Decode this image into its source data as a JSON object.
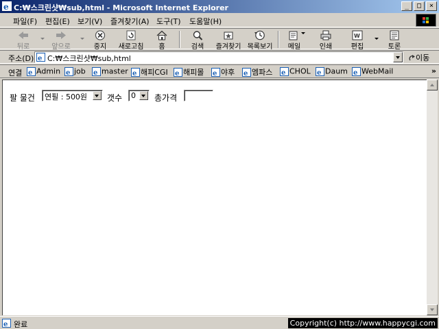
{
  "window": {
    "title": "C:₩스크린샷₩sub,html - Microsoft Internet Explorer",
    "min_glyph": "_",
    "max_glyph": "□",
    "close_glyph": "×"
  },
  "menu": [
    "파일(F)",
    "편집(E)",
    "보기(V)",
    "즐겨찾기(A)",
    "도구(T)",
    "도움말(H)"
  ],
  "toolbar": {
    "back": "뒤로",
    "forward": "앞으로",
    "stop": "중지",
    "refresh": "새로고침",
    "home": "홈",
    "search": "검색",
    "favorites": "즐겨찾기",
    "history": "목록보기",
    "mail": "메일",
    "print": "인쇄",
    "edit": "편집",
    "discuss": "토론"
  },
  "address": {
    "label": "주소(D)",
    "value": "C:₩스크린샷₩sub,html",
    "go": "이동"
  },
  "links": {
    "label": "연결",
    "items": [
      "Admin",
      "job",
      "master",
      "해피CGI",
      "해피몰",
      "야후",
      "엠파스",
      "CHOL",
      "Daum",
      "WebMail"
    ],
    "more": "»"
  },
  "form": {
    "item_label": "팔 물건",
    "item_selected": "연필 : 500원",
    "qty_label": "갯수",
    "qty_selected": "0",
    "total_label": "총가격",
    "total_value": ""
  },
  "status": {
    "text": "완료",
    "copyright": "Copyright(c) http://www.happycgi.com"
  },
  "colors": {
    "titlebar_start": "#0a246a",
    "titlebar_end": "#a6caf0",
    "chrome": "#d4d0c8",
    "content_bg": "#ffffff"
  }
}
